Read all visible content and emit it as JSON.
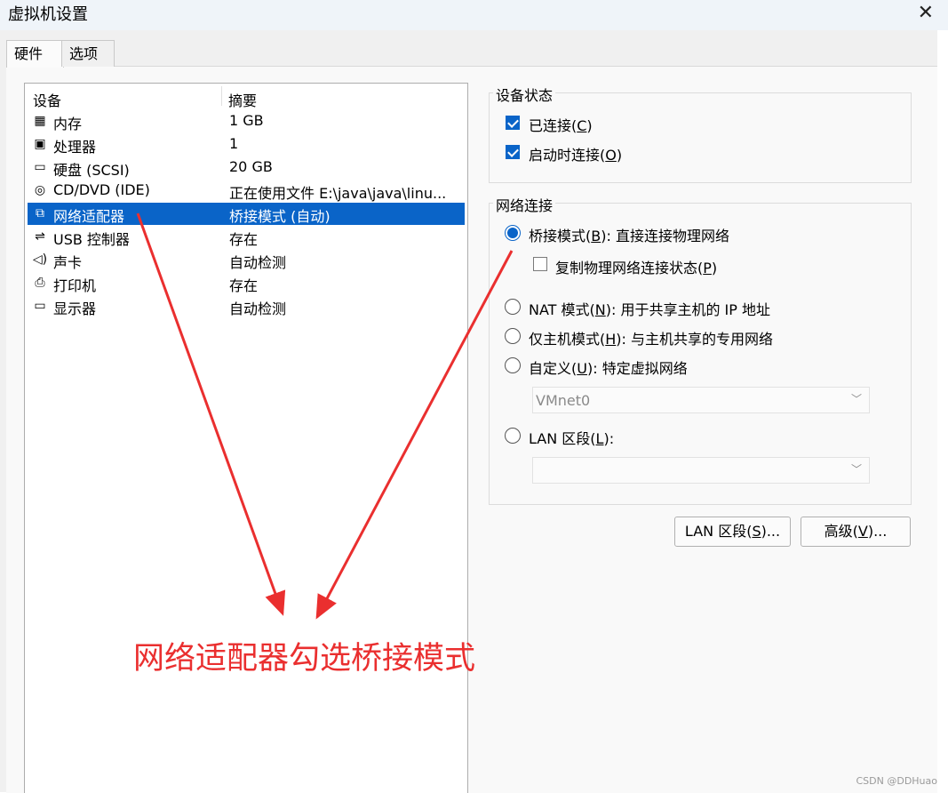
{
  "window": {
    "title": "虚拟机设置",
    "close_icon": "✕"
  },
  "tabs": [
    {
      "label": "硬件",
      "active": true
    },
    {
      "label": "选项",
      "active": false
    }
  ],
  "device_list": {
    "col_device": "设备",
    "col_summary": "摘要",
    "items": [
      {
        "icon": "memory-icon",
        "glyph": "▦",
        "name": "内存",
        "summary": "1 GB"
      },
      {
        "icon": "processor-icon",
        "glyph": "▣",
        "name": "处理器",
        "summary": "1"
      },
      {
        "icon": "harddisk-icon",
        "glyph": "▭",
        "name": "硬盘 (SCSI)",
        "summary": "20 GB"
      },
      {
        "icon": "cd-dvd-icon",
        "glyph": "◎",
        "name": "CD/DVD (IDE)",
        "summary": "正在使用文件 E:\\java\\java\\linu..."
      },
      {
        "icon": "network-adapter-icon",
        "glyph": "⧉",
        "name": "网络适配器",
        "summary": "桥接模式 (自动)",
        "selected": true
      },
      {
        "icon": "usb-icon",
        "glyph": "⇌",
        "name": "USB 控制器",
        "summary": "存在"
      },
      {
        "icon": "sound-icon",
        "glyph": "◁)",
        "name": "声卡",
        "summary": "自动检测"
      },
      {
        "icon": "printer-icon",
        "glyph": "⎙",
        "name": "打印机",
        "summary": "存在"
      },
      {
        "icon": "display-icon",
        "glyph": "▭",
        "name": "显示器",
        "summary": "自动检测"
      }
    ]
  },
  "device_status": {
    "title": "设备状态",
    "connected": {
      "label": "已连接(",
      "key": "C",
      "end": ")",
      "checked": true
    },
    "connect_on_start": {
      "label": "启动时连接(",
      "key": "O",
      "end": ")",
      "checked": true
    }
  },
  "network": {
    "title": "网络连接",
    "bridged": {
      "prefix": "桥接模式(",
      "key": "B",
      "suffix": "): 直接连接物理网络",
      "selected": true
    },
    "replicate": {
      "prefix": "复制物理网络连接状态(",
      "key": "P",
      "suffix": ")",
      "checked": false
    },
    "nat": {
      "prefix": "NAT 模式(",
      "key": "N",
      "suffix": "): 用于共享主机的 IP 地址"
    },
    "host_only": {
      "prefix": "仅主机模式(",
      "key": "H",
      "suffix": "): 与主机共享的专用网络"
    },
    "custom": {
      "prefix": "自定义(",
      "key": "U",
      "suffix": "): 特定虚拟网络"
    },
    "custom_value": "VMnet0",
    "lan": {
      "prefix": "LAN 区段(",
      "key": "L",
      "suffix": "):"
    },
    "lan_value": ""
  },
  "buttons": {
    "lan_segments": {
      "prefix": "LAN 区段(",
      "key": "S",
      "suffix": ")..."
    },
    "advanced": {
      "prefix": "高级(",
      "key": "V",
      "suffix": ")..."
    }
  },
  "annotation": "网络适配器勾选桥接模式",
  "watermark": "CSDN @DDHuao",
  "colors": {
    "accent": "#0a64c8",
    "annotation": "#ea2f2f"
  }
}
